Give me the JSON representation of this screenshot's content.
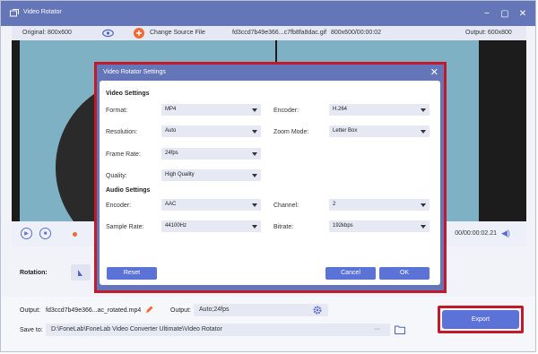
{
  "titlebar": {
    "title": "Video Rotator",
    "minimize": "−",
    "maximize": "▢",
    "close": "✕"
  },
  "info": {
    "original": "Original: 800x600",
    "change_source": "Change Source File",
    "filename": "fd3ccd7b49e366...c7fb8fa8dac.gif",
    "dims_time": "800x600/00:00:02",
    "output": "Output: 600x800"
  },
  "playback": {
    "time": "00/00:00:02.21"
  },
  "rotation": {
    "label": "Rotation:"
  },
  "dialog": {
    "title": "Video Rotator Settings",
    "video_settings": "Video Settings",
    "audio_settings": "Audio Settings",
    "format_label": "Format:",
    "format_value": "MP4",
    "encoder_label": "Encoder:",
    "encoder_value": "H.264",
    "resolution_label": "Resolution:",
    "resolution_value": "Auto",
    "zoom_label": "Zoom Mode:",
    "zoom_value": "Letter Box",
    "framerate_label": "Frame Rate:",
    "framerate_value": "24fps",
    "quality_label": "Quality:",
    "quality_value": "High Quality",
    "aenc_label": "Encoder:",
    "aenc_value": "AAC",
    "channel_label": "Channel:",
    "channel_value": "2",
    "samplerate_label": "Sample Rate:",
    "samplerate_value": "44100Hz",
    "bitrate_label": "Bitrate:",
    "bitrate_value": "192kbps",
    "reset": "Reset",
    "cancel": "Cancel",
    "ok": "OK"
  },
  "bottom": {
    "output_label": "Output:",
    "output_file": "fd3ccd7b49e366...ac_rotated.mp4",
    "output2_label": "Output:",
    "output2_value": "Auto;24fps",
    "save_label": "Save to:",
    "save_path": "D:\\FoneLab\\FoneLab Video Converter Ultimate\\Video Rotator",
    "more": "···",
    "export": "Export"
  },
  "colors": {
    "accent": "#5b72d6",
    "titlebar": "#6576b8",
    "highlight": "#c21a2a"
  }
}
